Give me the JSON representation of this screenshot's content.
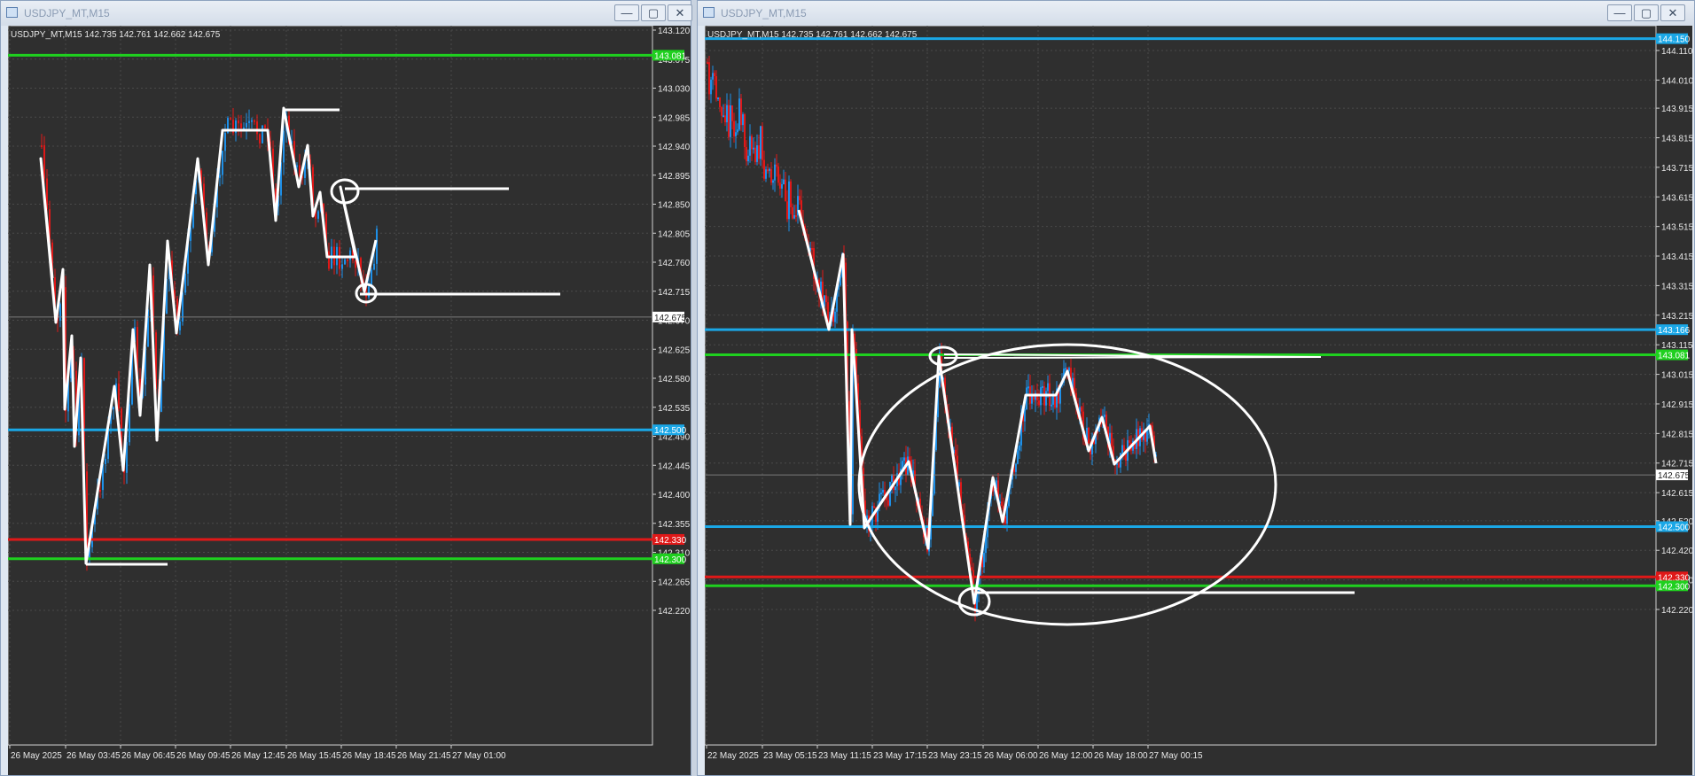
{
  "windows": [
    {
      "title": "USDJPY_MT,M15",
      "header": "USDJPY_MT,M15  142.735 142.761 142.662 142.675",
      "controls": {
        "minimize": "—",
        "maximize": "▢",
        "close": "✕"
      },
      "y_ticks": [
        "143.120",
        "143.075",
        "143.030",
        "142.985",
        "142.940",
        "142.895",
        "142.850",
        "142.805",
        "142.760",
        "142.715",
        "142.670",
        "142.625",
        "142.580",
        "142.535",
        "142.490",
        "142.445",
        "142.400",
        "142.355",
        "142.310",
        "142.265",
        "142.220"
      ],
      "x_ticks": [
        "26 May 2025",
        "26 May 03:45",
        "26 May 06:45",
        "26 May 09:45",
        "26 May 12:45",
        "26 May 15:45",
        "26 May 18:45",
        "26 May 21:45",
        "27 May 01:00"
      ],
      "levels": [
        {
          "price": 143.081,
          "label": "143.081",
          "color": "#1fd01f"
        },
        {
          "price": 142.5,
          "label": "142.500",
          "color": "#1aa7e6"
        },
        {
          "price": 142.33,
          "label": "142.330",
          "color": "#e01818"
        },
        {
          "price": 142.3,
          "label": "142.300",
          "color": "#1fd01f"
        }
      ],
      "current_price": {
        "price": 142.675,
        "label": "142.675"
      }
    },
    {
      "title": "USDJPY_MT,M15",
      "header": "USDJPY_MT,M15  142.735 142.761 142.662 142.675",
      "controls": {
        "minimize": "—",
        "maximize": "▢",
        "close": "✕"
      },
      "y_ticks": [
        "144.110",
        "144.010",
        "143.915",
        "143.815",
        "143.715",
        "143.615",
        "143.515",
        "143.415",
        "143.315",
        "143.215",
        "143.115",
        "143.015",
        "142.915",
        "142.815",
        "142.715",
        "142.615",
        "142.520",
        "142.420",
        "142.320",
        "142.220"
      ],
      "x_ticks": [
        "22 May 2025",
        "23 May 05:15",
        "23 May 11:15",
        "23 May 17:15",
        "23 May 23:15",
        "26 May 06:00",
        "26 May 12:00",
        "26 May 18:00",
        "27 May 00:15"
      ],
      "levels": [
        {
          "price": 144.15,
          "label": "144.150",
          "color": "#1aa7e6"
        },
        {
          "price": 143.166,
          "label": "143.166",
          "color": "#1aa7e6"
        },
        {
          "price": 143.081,
          "label": "143.081",
          "color": "#1fd01f"
        },
        {
          "price": 142.5,
          "label": "142.500",
          "color": "#1aa7e6"
        },
        {
          "price": 142.33,
          "label": "142.330",
          "color": "#e01818"
        },
        {
          "price": 142.3,
          "label": "142.300",
          "color": "#1fd01f"
        }
      ],
      "current_price": {
        "price": 142.675,
        "label": "142.675"
      }
    }
  ],
  "colors": {
    "bull": "#1e90e8",
    "bear": "#e01818",
    "background": "#2f2f2f",
    "grid": "#4a4a4a",
    "text": "#e8e8e8",
    "drawing": "#ffffff"
  }
}
